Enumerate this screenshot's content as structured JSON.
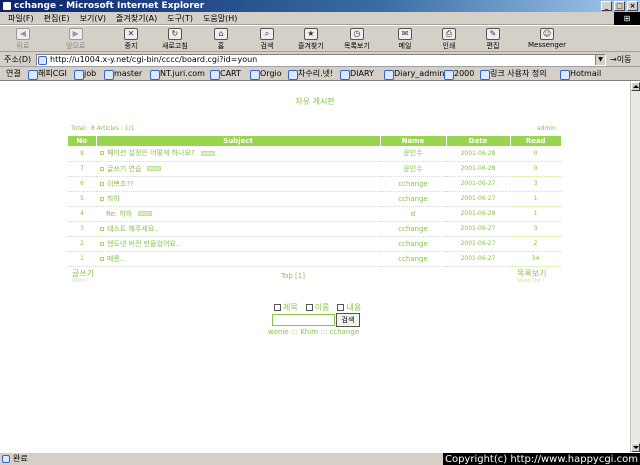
{
  "window": {
    "title": "cchange - Microsoft Internet Explorer"
  },
  "menubar": [
    "파일(F)",
    "편집(E)",
    "보기(V)",
    "즐겨찾기(A)",
    "도구(T)",
    "도움말(H)"
  ],
  "toolbar": {
    "back": "뒤로",
    "forward": "앞으로",
    "stop": "중지",
    "refresh": "새로고침",
    "home": "홈",
    "search": "검색",
    "favorites": "즐겨찾기",
    "history": "목록보기",
    "mail": "메일",
    "print": "인쇄",
    "edit": "편집",
    "messenger": "Messenger"
  },
  "address": {
    "label": "주소(D)",
    "url": "http://u1004.x-y.net/cgi-bin/cccc/board.cgi?id=youn",
    "go": "이동"
  },
  "links": {
    "label": "연결",
    "items": [
      "해피CGI",
      "job",
      "master",
      "NT.juri.com",
      "CART",
      "Orgio",
      "차수리.넷!",
      "DIARY",
      "Diary_admin",
      "2000",
      "링크 사용자 정의",
      "Hotmail"
    ]
  },
  "board": {
    "title": "자유 게시판",
    "total": "Total : 8 Articles : 1/1",
    "admin": "admin",
    "headers": {
      "no": "No",
      "subject": "Subject",
      "name": "Name",
      "date": "Date",
      "read": "Read"
    },
    "rows": [
      {
        "no": "8",
        "subject": "페이션 설정은 어떻게 하나요?",
        "name": "윤인수",
        "date": "2001-06-28",
        "read": "0"
      },
      {
        "no": "7",
        "subject": "글쓰기 연습",
        "name": "윤인수",
        "date": "2001-06-28",
        "read": "0"
      },
      {
        "no": "6",
        "subject": "이쁘죠??",
        "name": "cchange",
        "date": "2001-06-27",
        "read": "3"
      },
      {
        "no": "5",
        "subject": "하하",
        "name": "cchange",
        "date": "2001-06-27",
        "read": "1"
      },
      {
        "no": "4",
        "subject": "Re: 하하",
        "name": "d",
        "date": "2001-06-28",
        "read": "1"
      },
      {
        "no": "3",
        "subject": "테스트 해주세요..",
        "name": "cchange",
        "date": "2001-06-27",
        "read": "3"
      },
      {
        "no": "2",
        "subject": "엔도넷 버전 만들었어요..",
        "name": "cchange",
        "date": "2001-06-27",
        "read": "2"
      },
      {
        "no": "1",
        "subject": "메롱..",
        "name": "cchange",
        "date": "2001-06-27",
        "read": "34"
      }
    ],
    "write": "글쓰기",
    "write_sub": "Write !",
    "list": "목록보기",
    "list_sub": "Show List !",
    "pager": "Top  [1]"
  },
  "search": {
    "opt_title": "제목",
    "opt_name": "이름",
    "opt_content": "내용",
    "button": "검색"
  },
  "credits": "wonie ::: Khim ::: cchange",
  "status": {
    "text": "완료",
    "copyright": "Copyright(c) http://www.happycgi.com"
  },
  "colors": {
    "accent": "#9ad54f",
    "text_green": "#8ac34a"
  }
}
